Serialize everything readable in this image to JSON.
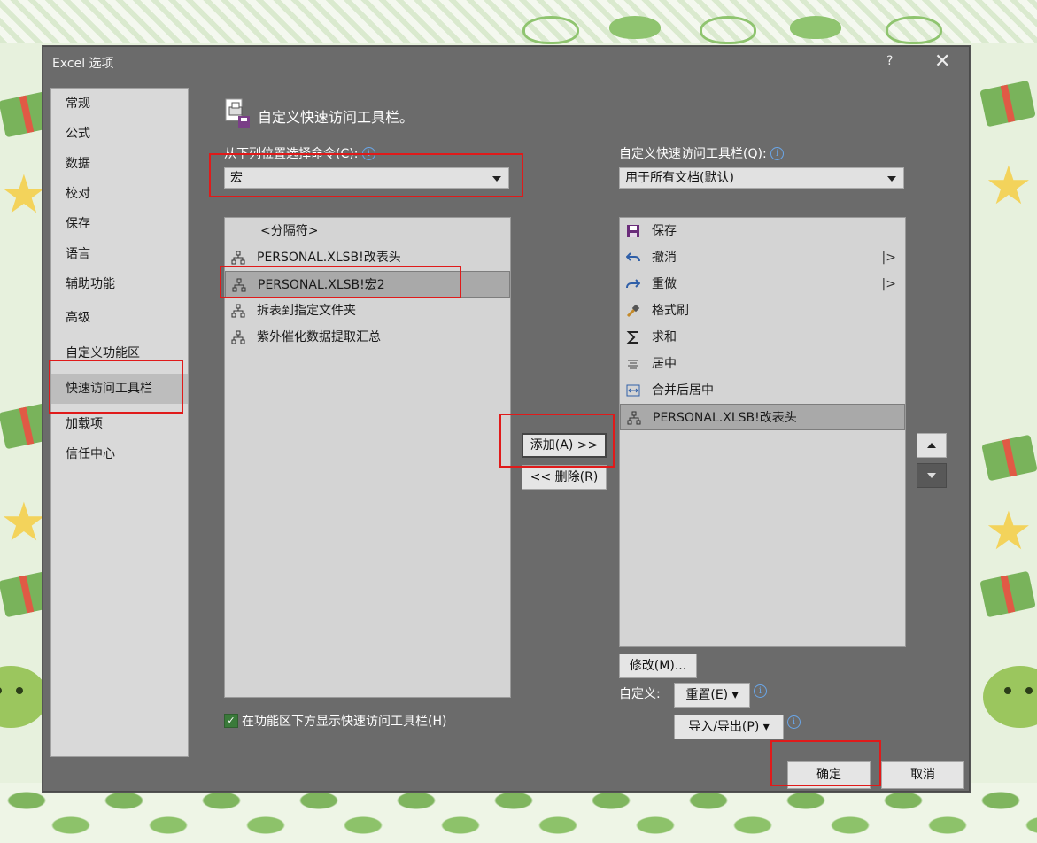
{
  "dialog": {
    "title": "Excel 选项",
    "help": "?",
    "close": "✕"
  },
  "nav": {
    "items": [
      {
        "label": "常规"
      },
      {
        "label": "公式"
      },
      {
        "label": "数据"
      },
      {
        "label": "校对"
      },
      {
        "label": "保存"
      },
      {
        "label": "语言"
      },
      {
        "label": "辅助功能"
      },
      {
        "label": "高级"
      },
      {
        "label": "自定义功能区"
      },
      {
        "label": "快速访问工具栏"
      },
      {
        "label": "加载项"
      },
      {
        "label": "信任中心"
      }
    ],
    "selected": "快速访问工具栏"
  },
  "section_title": "自定义快速访问工具栏。",
  "choose_from": {
    "label": "从下列位置选择命令(C):",
    "value": "宏"
  },
  "customize_for": {
    "label": "自定义快速访问工具栏(Q):",
    "value": "用于所有文档(默认)"
  },
  "left_list": [
    {
      "label": "<分隔符>",
      "icon": "none"
    },
    {
      "label": "PERSONAL.XLSB!改表头",
      "icon": "macro-icon"
    },
    {
      "label": "PERSONAL.XLSB!宏2",
      "icon": "macro-icon",
      "selected": true
    },
    {
      "label": "拆表到指定文件夹",
      "icon": "macro-icon"
    },
    {
      "label": "紫外催化数据提取汇总",
      "icon": "macro-icon"
    }
  ],
  "right_list": [
    {
      "label": "保存",
      "icon": "save-icon"
    },
    {
      "label": "撤消",
      "icon": "undo-icon",
      "sub": "|>"
    },
    {
      "label": "重做",
      "icon": "redo-icon",
      "sub": "|>"
    },
    {
      "label": "格式刷",
      "icon": "format-painter-icon"
    },
    {
      "label": "求和",
      "icon": "sum-icon"
    },
    {
      "label": "居中",
      "icon": "align-center-icon"
    },
    {
      "label": "合并后居中",
      "icon": "merge-center-icon"
    },
    {
      "label": "PERSONAL.XLSB!改表头",
      "icon": "macro-icon",
      "selected": true
    }
  ],
  "buttons": {
    "add": "添加(A) >>",
    "remove": "<< 删除(R)",
    "modify": "修改(M)...",
    "customize_label": "自定义:",
    "reset": "重置(E) ▾",
    "import_export": "导入/导出(P) ▾",
    "ok": "确定",
    "cancel": "取消"
  },
  "checkbox": {
    "label": "在功能区下方显示快速访问工具栏(H)",
    "checked": true
  }
}
